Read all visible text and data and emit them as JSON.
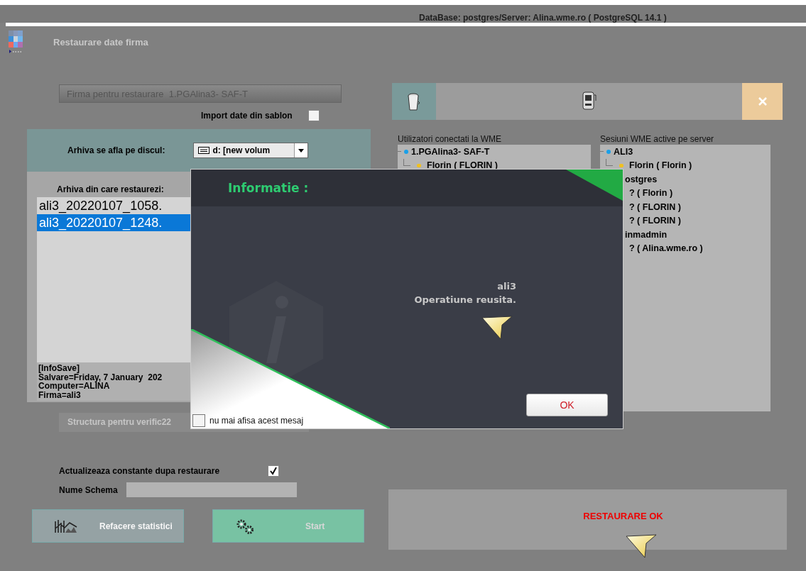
{
  "status_bar": {
    "text": "DataBase: postgres/Server: Alina.wme.ro ( PostgreSQL 14.1 )"
  },
  "window": {
    "title": "Restaurare date firma"
  },
  "firm_bar": {
    "text": "Firma pentru restaurare  1.PGAlina3- SAF-T"
  },
  "import_template": {
    "label": "Import date din sablon",
    "checked": false
  },
  "disk": {
    "label": "Arhiva se afla pe discul:",
    "value": "d: [new volum"
  },
  "archives": {
    "label": "Arhiva din care restaurezi:",
    "items": [
      {
        "text": "ali3_20220107_1058.",
        "selected": false
      },
      {
        "text": "ali3_20220107_1248.",
        "selected": true
      }
    ]
  },
  "info_lines": [
    "[InfoSave]",
    "Salvare=Friday, 7 January  202",
    "Computer=ALINA",
    "Firma=ali3"
  ],
  "structure_bar": {
    "text": "Structura pentru verific22"
  },
  "update_constants": {
    "label": "Actualizeaza constante dupa restaurare",
    "checked": true
  },
  "schema": {
    "label": "Nume Schema"
  },
  "buttons": [
    {
      "label": "Refacere statistici",
      "kind": "stats"
    },
    {
      "label": "Start",
      "kind": "start"
    }
  ],
  "toolbar": [
    {
      "kind": "bin"
    },
    {
      "kind": "machine"
    },
    {
      "kind": "close"
    }
  ],
  "users_panel": {
    "title": "Utilizatori conectati la WME",
    "tree": [
      {
        "text": "1.PGAlina3- SAF-T",
        "cut": false,
        "children": [
          {
            "text": "Florin ( FLORIN )"
          }
        ]
      }
    ]
  },
  "sessions_panel": {
    "title": "Sesiuni WME active pe server",
    "tree": [
      {
        "text": "ALI3",
        "cut": false,
        "children": [
          {
            "text": "Florin ( Florin )"
          }
        ]
      },
      {
        "text": "ostgres",
        "cut": true,
        "children": [
          {
            "text": "? ( Florin )"
          },
          {
            "text": "? ( FLORIN )"
          },
          {
            "text": "? ( FLORIN )"
          }
        ]
      },
      {
        "text": "inmadmin",
        "cut": true,
        "children": [
          {
            "text": "? ( Alina.wme.ro )"
          }
        ]
      }
    ]
  },
  "result": {
    "text": "RESTAURARE OK"
  },
  "dialog": {
    "title": "Informatie :",
    "message": [
      "ali3",
      "Operatiune reusita."
    ],
    "dont_show": {
      "label": "nu mai afisa acest mesaj",
      "checked": false
    },
    "ok": "OK"
  }
}
